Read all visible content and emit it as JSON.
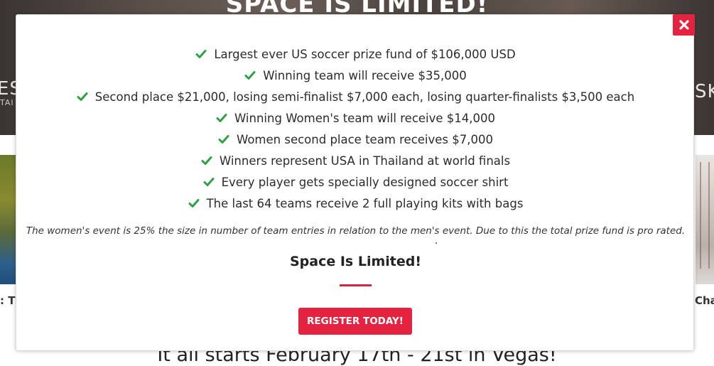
{
  "background": {
    "hero_title": "SPACE IS LIMITED!",
    "hero_left_fragment": "ES",
    "hero_left_sub_fragment": "TAI",
    "hero_right_fragment": "SK",
    "caption_left_fragment": ": Th",
    "caption_right_fragment": "Cha",
    "bottom_headline": "It all starts February 17th - 21st in Vegas!"
  },
  "modal": {
    "close_icon": "close-icon",
    "check_icon": "check-icon",
    "prize_items": [
      "Largest ever US soccer prize fund of $106,000 USD",
      "Winning team will receive $35,000",
      "Second place $21,000, losing semi-finalist $7,000 each, losing quarter-finalists $3,500 each",
      "Winning Women's team will receive $14,000",
      "Women second place team receives $7,000",
      "Winners represent USA in Thailand at world finals",
      "Every player gets specially designed soccer shirt",
      "The last 64 teams receive 2 full playing kits with bags"
    ],
    "note": "The women's event is 25% the size in number of team entries in relation to the men's event. Due to this the total prize fund is pro rated.",
    "heading": "Space Is Limited!",
    "register_label": "REGISTER TODAY!"
  },
  "colors": {
    "accent_red": "#e3233f",
    "check_green": "#2ea043",
    "text_dark": "#2b2b2b"
  }
}
